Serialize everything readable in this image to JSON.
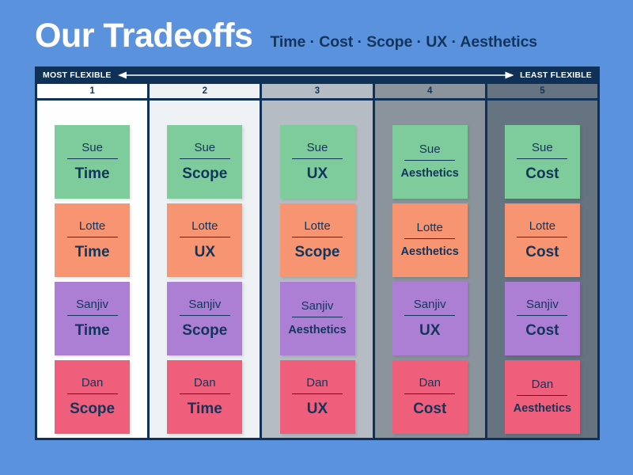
{
  "header": {
    "title": "Our Tradeoffs",
    "subtitle": "Time · Cost · Scope · UX · Aesthetics"
  },
  "flex_bar": {
    "left_label": "MOST FLEXIBLE",
    "right_label": "LEAST FLEXIBLE",
    "bar_color": "#0f3057",
    "arrow_color": "#ffffff"
  },
  "palette": {
    "background": "#5b92de",
    "navy": "#0f3057",
    "text_navy": "#12355b",
    "row_colors": {
      "Sue": "#7ecb9b",
      "Lotte": "#f79471",
      "Sanjiv": "#ad7fd4",
      "Dan": "#ef5f7c"
    }
  },
  "people": [
    "Sue",
    "Lotte",
    "Sanjiv",
    "Dan"
  ],
  "columns": [
    {
      "rank": "1",
      "bg": "#ffffff",
      "cards": [
        {
          "name": "Sue",
          "value": "Time",
          "color": "#7ecb9b"
        },
        {
          "name": "Lotte",
          "value": "Time",
          "color": "#f79471"
        },
        {
          "name": "Sanjiv",
          "value": "Time",
          "color": "#ad7fd4"
        },
        {
          "name": "Dan",
          "value": "Scope",
          "color": "#ef5f7c"
        }
      ]
    },
    {
      "rank": "2",
      "bg": "#eef1f3",
      "cards": [
        {
          "name": "Sue",
          "value": "Scope",
          "color": "#7ecb9b"
        },
        {
          "name": "Lotte",
          "value": "UX",
          "color": "#f79471"
        },
        {
          "name": "Sanjiv",
          "value": "Scope",
          "color": "#ad7fd4"
        },
        {
          "name": "Dan",
          "value": "Time",
          "color": "#ef5f7c"
        }
      ]
    },
    {
      "rank": "3",
      "bg": "#b5bcc4",
      "cards": [
        {
          "name": "Sue",
          "value": "UX",
          "color": "#7ecb9b"
        },
        {
          "name": "Lotte",
          "value": "Scope",
          "color": "#f79471"
        },
        {
          "name": "Sanjiv",
          "value": "Aesthetics",
          "color": "#ad7fd4"
        },
        {
          "name": "Dan",
          "value": "UX",
          "color": "#ef5f7c"
        }
      ]
    },
    {
      "rank": "4",
      "bg": "#8b939c",
      "cards": [
        {
          "name": "Sue",
          "value": "Aesthetics",
          "color": "#7ecb9b"
        },
        {
          "name": "Lotte",
          "value": "Aesthetics",
          "color": "#f79471"
        },
        {
          "name": "Sanjiv",
          "value": "UX",
          "color": "#ad7fd4"
        },
        {
          "name": "Dan",
          "value": "Cost",
          "color": "#ef5f7c"
        }
      ]
    },
    {
      "rank": "5",
      "bg": "#667380",
      "cards": [
        {
          "name": "Sue",
          "value": "Cost",
          "color": "#7ecb9b"
        },
        {
          "name": "Lotte",
          "value": "Cost",
          "color": "#f79471"
        },
        {
          "name": "Sanjiv",
          "value": "Cost",
          "color": "#ad7fd4"
        },
        {
          "name": "Dan",
          "value": "Aesthetics",
          "color": "#ef5f7c"
        }
      ]
    }
  ]
}
